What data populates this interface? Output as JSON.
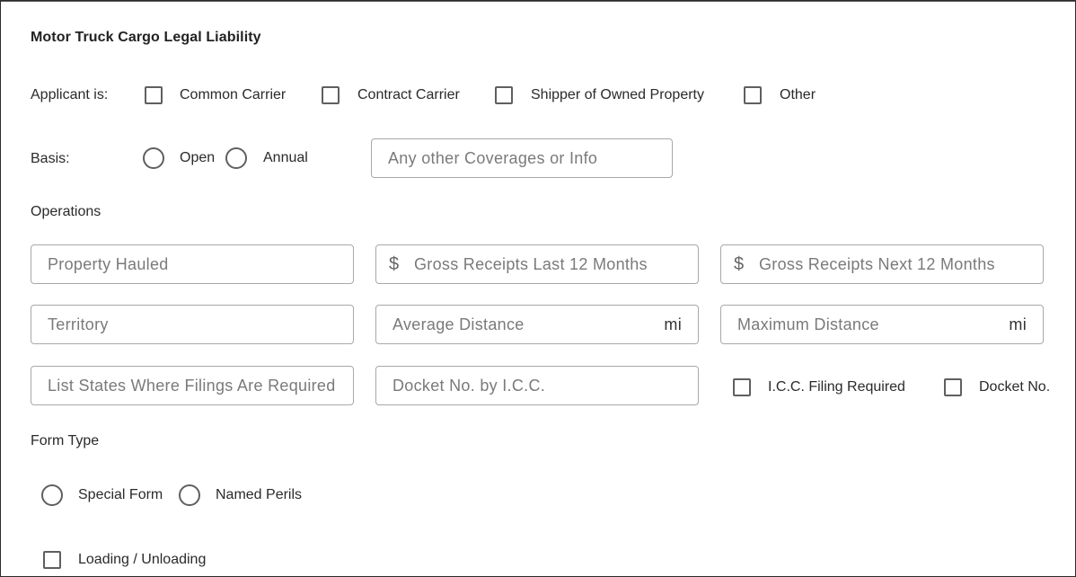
{
  "section_title": "Motor Truck Cargo Legal Liability",
  "applicant": {
    "label": "Applicant is:",
    "options": [
      {
        "label": "Common Carrier",
        "checked": false
      },
      {
        "label": "Contract Carrier",
        "checked": false
      },
      {
        "label": "Shipper of Owned Property",
        "checked": false
      },
      {
        "label": "Other",
        "checked": false
      }
    ]
  },
  "basis": {
    "label": "Basis:",
    "options": [
      {
        "label": "Open",
        "selected": false
      },
      {
        "label": "Annual",
        "selected": false
      }
    ],
    "other_coverages_placeholder": "Any other Coverages or Info"
  },
  "operations": {
    "label": "Operations",
    "property_hauled_placeholder": "Property Hauled",
    "gross_last_prefix": "$",
    "gross_last_placeholder": "Gross Receipts Last 12 Months",
    "gross_next_prefix": "$",
    "gross_next_placeholder": "Gross Receipts Next 12 Months",
    "territory_placeholder": "Territory",
    "avg_distance_placeholder": "Average Distance",
    "avg_distance_unit": "mi",
    "max_distance_placeholder": "Maximum Distance",
    "max_distance_unit": "mi",
    "filing_states_placeholder": "List States Where Filings Are Required",
    "docket_icc_placeholder": "Docket No. by I.C.C.",
    "icc_filing_required_label": "I.C.C. Filing Required",
    "docket_no_label": "Docket No."
  },
  "form_type": {
    "label": "Form Type",
    "options": [
      {
        "label": "Special Form",
        "selected": false
      },
      {
        "label": "Named Perils",
        "selected": false
      }
    ]
  },
  "loading_unloading_label": "Loading / Unloading"
}
